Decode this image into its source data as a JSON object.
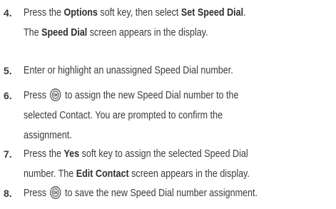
{
  "steps": [
    {
      "number": "4.",
      "lines": [
        [
          "Press the ",
          {
            "b": "Options"
          },
          " soft key, then select ",
          {
            "b": "Set Speed Dial"
          },
          "."
        ],
        [
          "The ",
          {
            "b": "Speed Dial"
          },
          " screen appears in the display."
        ]
      ]
    },
    {
      "number": "5.",
      "lines": [
        [
          "Enter or highlight an unassigned Speed Dial number."
        ]
      ]
    },
    {
      "number": "6.",
      "lines": [
        [
          "Press ",
          {
            "icon": "ok-key-icon"
          },
          " to assign the new Speed Dial number to the"
        ],
        [
          "selected Contact. You are prompted to confirm the"
        ],
        [
          "assignment."
        ]
      ]
    },
    {
      "number": "7.",
      "lines": [
        [
          "Press the ",
          {
            "b": "Yes"
          },
          " soft key to assign the selected Speed Dial"
        ],
        [
          "number. The ",
          {
            "b": "Edit Contact"
          },
          " screen appears in the display."
        ]
      ]
    },
    {
      "number": "8.",
      "lines": [
        [
          "Press ",
          {
            "icon": "ok-key-icon"
          },
          " to save the new Speed Dial number assignment."
        ]
      ]
    }
  ],
  "icons": {
    "ok_key_label": "OK"
  }
}
